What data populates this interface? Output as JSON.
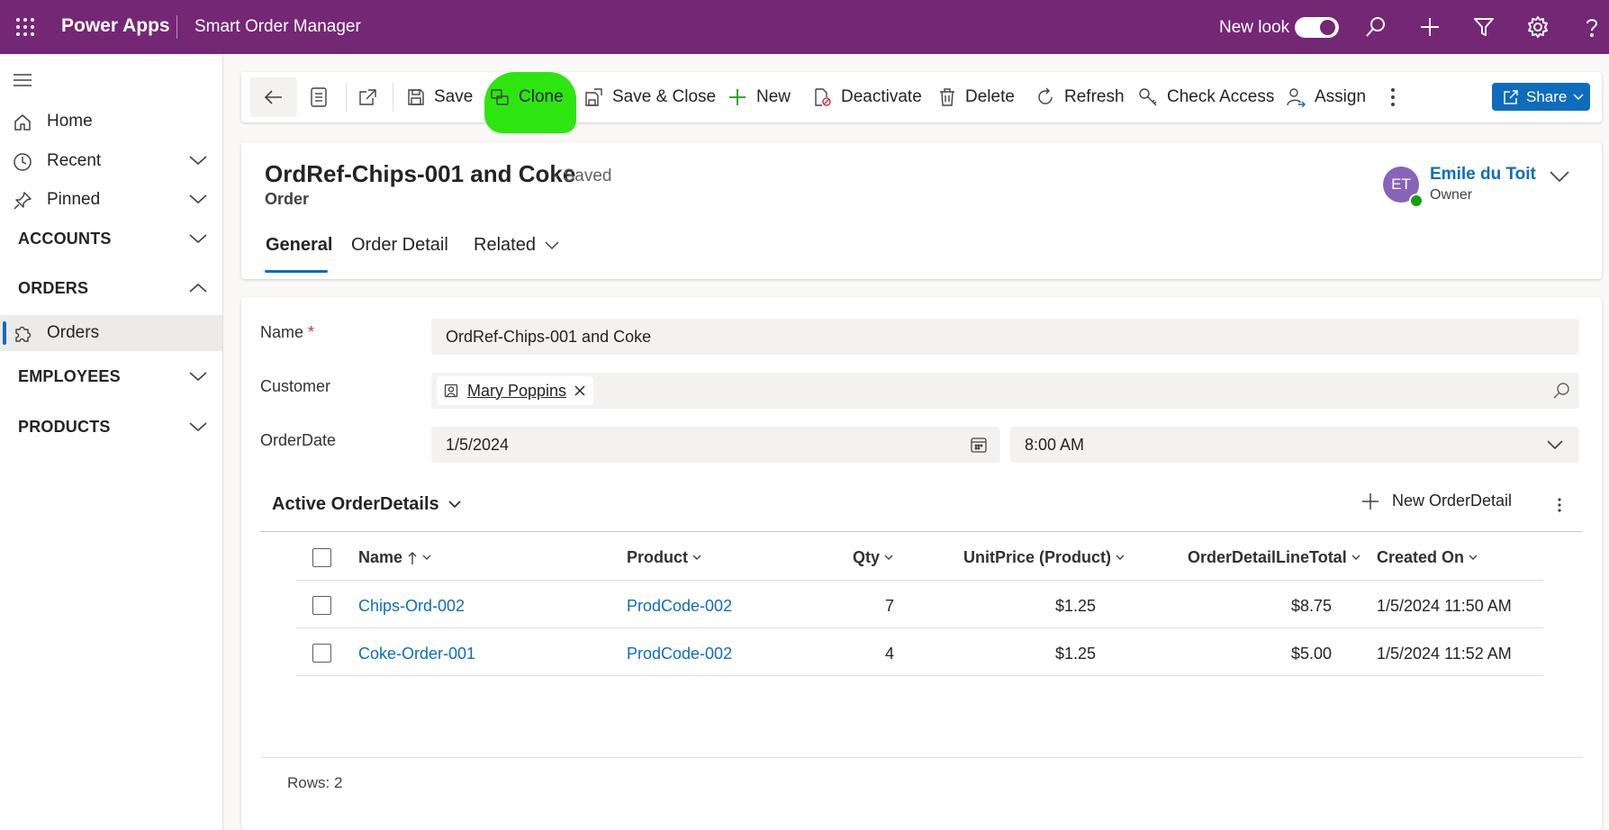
{
  "topbar": {
    "brand": "Power Apps",
    "app_name": "Smart Order Manager",
    "new_look_label": "New look",
    "new_look_on": true,
    "icons": [
      "search-icon",
      "add-icon",
      "filter-icon",
      "settings-icon",
      "help-icon"
    ]
  },
  "sidebar": {
    "items": [
      {
        "label": "Home",
        "icon": "home-icon"
      },
      {
        "label": "Recent",
        "icon": "clock-icon"
      },
      {
        "label": "Pinned",
        "icon": "pin-icon"
      }
    ],
    "groups": {
      "accounts": "ACCOUNTS",
      "orders": "ORDERS",
      "orders_item": "Orders",
      "employees": "EMPLOYEES",
      "products": "PRODUCTS"
    }
  },
  "commands": {
    "save": "Save",
    "clone": "Clone",
    "save_close": "Save & Close",
    "new": "New",
    "deactivate": "Deactivate",
    "delete": "Delete",
    "refresh": "Refresh",
    "check_access": "Check Access",
    "assign": "Assign",
    "share": "Share"
  },
  "record": {
    "title": "OrdRef-Chips-001 and Coke",
    "status": "- Saved",
    "entity": "Order",
    "owner": {
      "initials": "ET",
      "name": "Emile du Toit",
      "role": "Owner"
    },
    "tabs": [
      "General",
      "Order Detail",
      "Related"
    ]
  },
  "form": {
    "name_label": "Name",
    "required_mark": "*",
    "name_value": "OrdRef-Chips-001 and Coke",
    "customer_label": "Customer",
    "customer_value": "Mary Poppins",
    "orderdate_label": "OrderDate",
    "date_value": "1/5/2024",
    "time_value": "8:00 AM"
  },
  "subgrid": {
    "title": "Active OrderDetails",
    "new_label": "New OrderDetail",
    "columns": [
      "Name",
      "Product",
      "Qty",
      "UnitPrice (Product)",
      "OrderDetailLineTotal",
      "Created On"
    ],
    "rows": [
      {
        "name": "Chips-Ord-002",
        "product": "ProdCode-002",
        "qty": "7",
        "unit_price": "$1.25",
        "line_total": "$8.75",
        "created_on": "1/5/2024 11:50 AM"
      },
      {
        "name": "Coke-Order-001",
        "product": "ProdCode-002",
        "qty": "4",
        "unit_price": "$1.25",
        "line_total": "$5.00",
        "created_on": "1/5/2024 11:52 AM"
      }
    ],
    "rows_label": "Rows: 2"
  },
  "colors": {
    "brand": "#742774",
    "accent": "#0f6cbd",
    "highlight": "#2ee60f"
  }
}
